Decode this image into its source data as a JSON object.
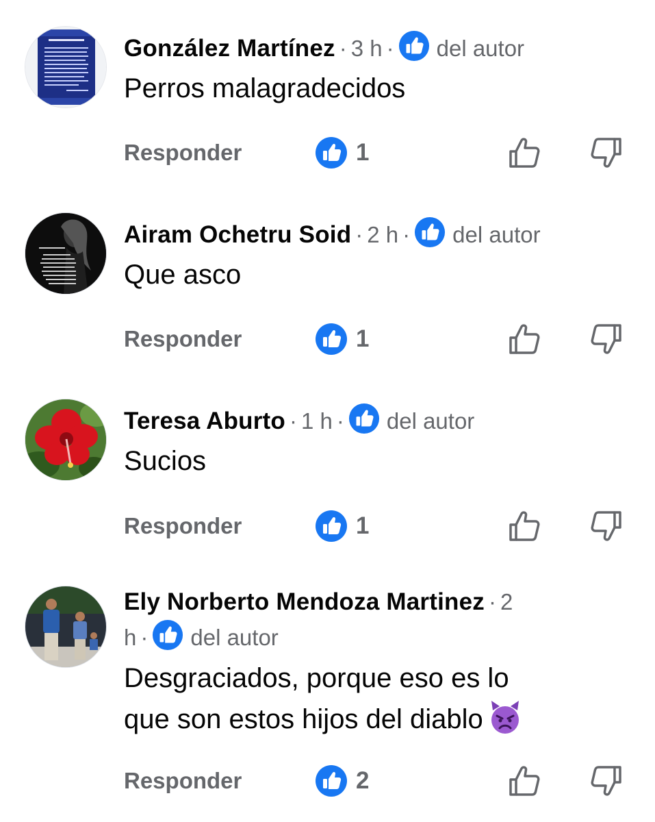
{
  "colors": {
    "accent": "#1877f2",
    "secondary_text": "#65676b",
    "primary_text": "#050505"
  },
  "comments": [
    {
      "author": "González Martínez",
      "time": "3 h",
      "badge_label": "del autor",
      "text": "Perros malagradecidos",
      "reply_label": "Responder",
      "like_count": "1",
      "avatar_icon": "scroll-document-avatar"
    },
    {
      "author": "Airam Ochetru Soid",
      "time": "2 h",
      "badge_label": "del autor",
      "text": "Que asco",
      "reply_label": "Responder",
      "like_count": "1",
      "avatar_icon": "woman-silhouette-avatar"
    },
    {
      "author": "Teresa Aburto",
      "time": "1 h",
      "badge_label": "del autor",
      "text": "Sucios",
      "reply_label": "Responder",
      "like_count": "1",
      "avatar_icon": "hibiscus-flower-avatar"
    },
    {
      "author": "Ely Norberto Mendoza Martinez",
      "time_part1": "2",
      "time_part2": "h",
      "badge_label": "del autor",
      "text_line1": "Desgraciados, porque eso es lo",
      "text_line2": "que son estos hijos del diablo",
      "reply_label": "Responder",
      "like_count": "2",
      "avatar_icon": "family-photo-avatar",
      "emoji": "angry-devil-emoji"
    }
  ]
}
